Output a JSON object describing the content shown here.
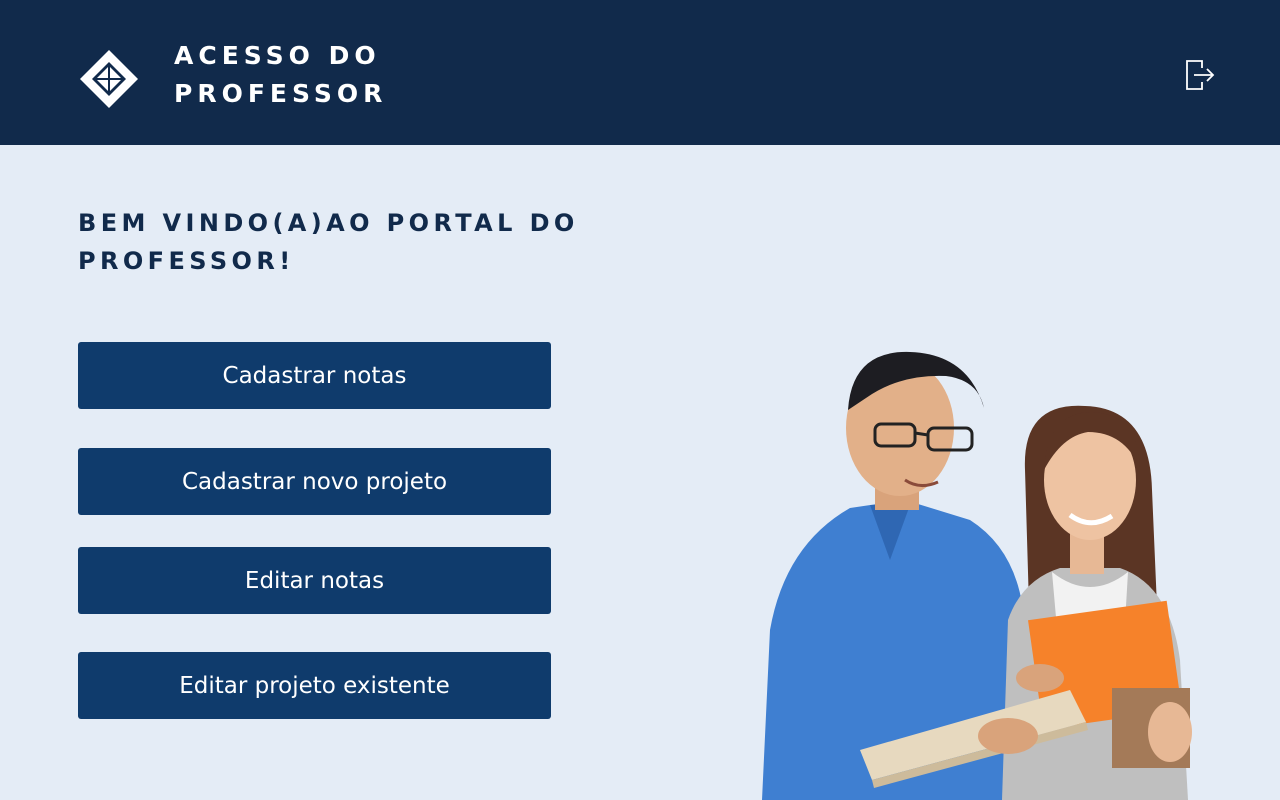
{
  "header": {
    "title_line1": "ACESSO DO",
    "title_line2": "PROFESSOR",
    "logo_icon": "diamond-logo-icon",
    "logout_icon": "logout-icon"
  },
  "main": {
    "welcome_line1": "BEM VINDO(A)AO PORTAL DO",
    "welcome_line2": "PROFESSOR!",
    "buttons": [
      {
        "label": "Cadastrar notas"
      },
      {
        "label": "Cadastrar novo projeto"
      },
      {
        "label": "Editar notas"
      },
      {
        "label": "Editar projeto existente"
      }
    ]
  },
  "colors": {
    "header_bg": "#112a4b",
    "page_bg": "#e4ecf6",
    "button_bg": "#0f3b6c",
    "button_text": "#ffffff"
  }
}
